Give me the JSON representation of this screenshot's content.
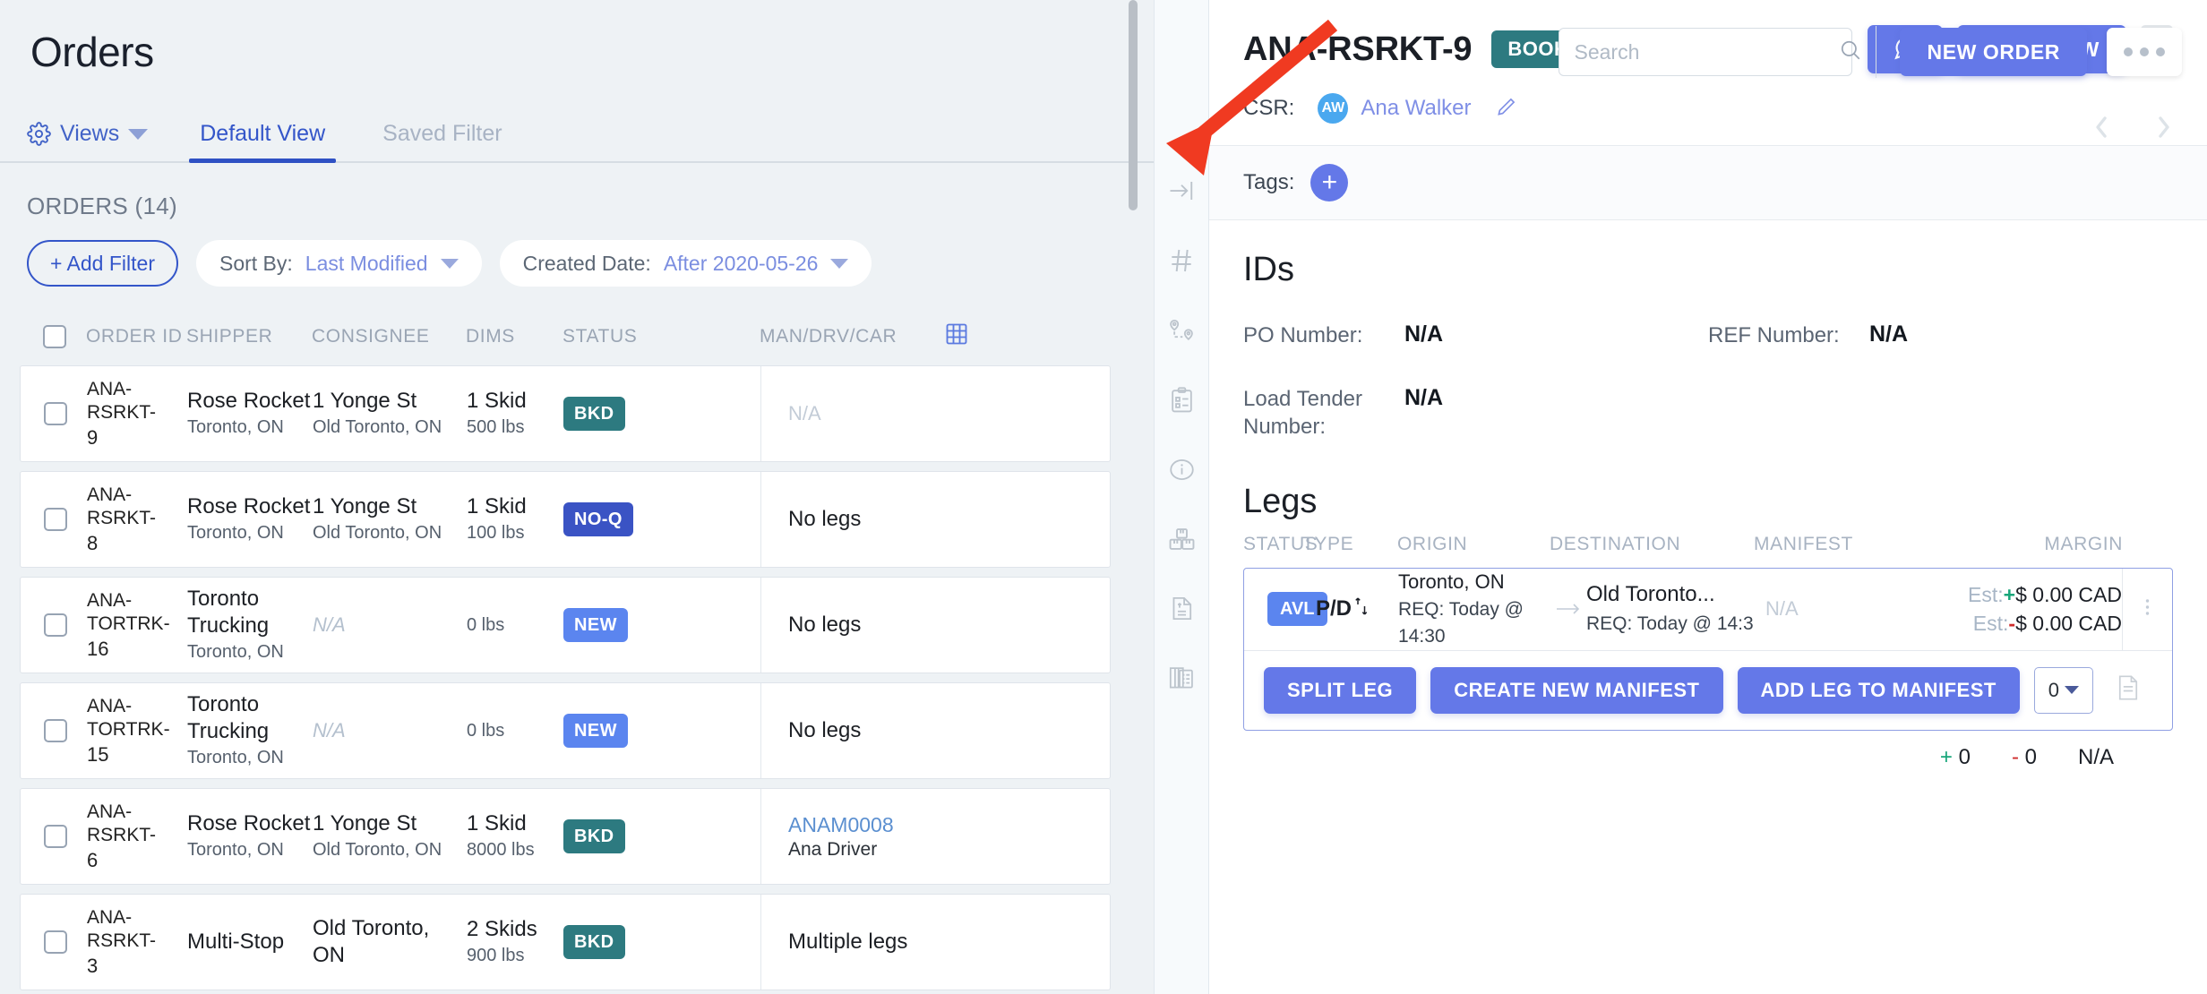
{
  "header": {
    "title": "Orders",
    "search_placeholder": "Search",
    "search_value": "",
    "new_order_label": "NEW ORDER",
    "more_icon": "ellipsis-icon"
  },
  "tabbar": {
    "views_label": "Views",
    "tabs": [
      {
        "label": "Default View",
        "active": true
      },
      {
        "label": "Saved Filter",
        "active": false
      }
    ],
    "prev_icon": "chevron-left-icon",
    "next_icon": "chevron-right-icon"
  },
  "list": {
    "count_label": "ORDERS (14)",
    "add_filter_label": "+ Add Filter",
    "sort_chip": {
      "label": "Sort By:",
      "value": "Last Modified"
    },
    "date_chip": {
      "label": "Created Date:",
      "value": "After 2020-05-26"
    },
    "columns": [
      "ORDER ID",
      "SHIPPER",
      "CONSIGNEE",
      "DIMS",
      "STATUS",
      "MAN/DRV/CAR"
    ],
    "grid_icon": "table-columns-icon",
    "rows": [
      {
        "order_id_top": "ANA-RSRKT-",
        "order_id_bottom": "9",
        "shipper_name": "Rose Rocket",
        "shipper_loc": "Toronto, ON",
        "consignee_name": "1 Yonge St",
        "consignee_loc": "Old Toronto, ON",
        "dims_main": "1 Skid",
        "dims_sub": "500 lbs",
        "status": "BKD",
        "status_type": "bkd",
        "legs_kind": "na",
        "legs_main": "N/A",
        "legs_sub": ""
      },
      {
        "order_id_top": "ANA-RSRKT-",
        "order_id_bottom": "8",
        "shipper_name": "Rose Rocket",
        "shipper_loc": "Toronto, ON",
        "consignee_name": "1 Yonge St",
        "consignee_loc": "Old Toronto, ON",
        "dims_main": "1 Skid",
        "dims_sub": "100 lbs",
        "status": "NO-Q",
        "status_type": "noq",
        "legs_kind": "text",
        "legs_main": "No legs",
        "legs_sub": ""
      },
      {
        "order_id_top": "ANA-TORTRK-",
        "order_id_bottom": "16",
        "shipper_name": "Toronto Trucking",
        "shipper_loc": "Toronto, ON",
        "consignee_name": "N/A",
        "consignee_loc": "",
        "dims_main": "",
        "dims_sub": "0 lbs",
        "status": "NEW",
        "status_type": "new",
        "legs_kind": "text",
        "legs_main": "No legs",
        "legs_sub": ""
      },
      {
        "order_id_top": "ANA-TORTRK-",
        "order_id_bottom": "15",
        "shipper_name": "Toronto Trucking",
        "shipper_loc": "Toronto, ON",
        "consignee_name": "N/A",
        "consignee_loc": "",
        "dims_main": "",
        "dims_sub": "0 lbs",
        "status": "NEW",
        "status_type": "new",
        "legs_kind": "text",
        "legs_main": "No legs",
        "legs_sub": ""
      },
      {
        "order_id_top": "ANA-RSRKT-",
        "order_id_bottom": "6",
        "shipper_name": "Rose Rocket",
        "shipper_loc": "Toronto, ON",
        "consignee_name": "1 Yonge St",
        "consignee_loc": "Old Toronto, ON",
        "dims_main": "1 Skid",
        "dims_sub": "8000 lbs",
        "status": "BKD",
        "status_type": "bkd",
        "legs_kind": "link",
        "legs_main": "ANAM0008",
        "legs_sub": "Ana Driver"
      },
      {
        "order_id_top": "ANA-RSRKT-",
        "order_id_bottom": "3",
        "shipper_name": "Multi-Stop",
        "shipper_loc": "",
        "consignee_name": "Old Toronto, ON",
        "consignee_loc": "",
        "dims_main": "2 Skids",
        "dims_sub": "900 lbs",
        "status": "BKD",
        "status_type": "bkd",
        "legs_kind": "text",
        "legs_main": "Multiple legs",
        "legs_sub": ""
      }
    ]
  },
  "rail": {
    "icons": [
      "collapse-panel-icon",
      "hash-icon",
      "route-pins-icon",
      "clipboard-checklist-icon",
      "info-circle-icon",
      "boxes-icon",
      "invoice-document-icon",
      "documents-stack-icon"
    ]
  },
  "detail": {
    "order_id": "ANA-RSRKT-9",
    "status_badge": "BOOKED",
    "chat_icon": "chat-bubble-icon",
    "full_view_label": "FULL VIEW",
    "kebab_icon": "vertical-ellipsis-icon",
    "csr_label": "CSR:",
    "csr_initials": "AW",
    "csr_name": "Ana Walker",
    "edit_icon": "pencil-icon",
    "tags_label": "Tags:",
    "tag_add_icon": "plus-icon",
    "ids": {
      "section_title": "IDs",
      "po_label": "PO Number:",
      "po_value": "N/A",
      "ref_label": "REF Number:",
      "ref_value": "N/A",
      "load_tender_label": "Load Tender Number:",
      "load_tender_value": "N/A"
    },
    "legs": {
      "section_title": "Legs",
      "columns": [
        "STATUS",
        "TYPE",
        "ORIGIN",
        "DESTINATION",
        "MANIFEST",
        "MARGIN"
      ],
      "row": {
        "status": "AVL",
        "type": "P/D",
        "origin_city": "Toronto, ON",
        "origin_req": "REQ: Today @ 14:30",
        "arrow_icon": "arrow-right-icon",
        "dest_city": "Old Toronto...",
        "dest_req": "REQ: Today @ 14:3",
        "manifest": "N/A",
        "margin_plus_label": "Est:",
        "margin_plus_sign": "+",
        "margin_plus_value": "$ 0.00 CAD",
        "margin_minus_label": "Est:",
        "margin_minus_sign": "-",
        "margin_minus_value": "$ 0.00 CAD",
        "kebab_icon": "vertical-ellipsis-icon"
      },
      "actions": {
        "split_leg": "SPLIT LEG",
        "create_manifest": "CREATE NEW MANIFEST",
        "add_to_manifest": "ADD LEG TO MANIFEST",
        "qty_value": "0",
        "note_icon": "note-icon"
      },
      "totals": {
        "plus_sign": "+",
        "plus_value": "0",
        "minus_sign": "-",
        "minus_value": "0",
        "net_value": "N/A"
      }
    }
  },
  "annotation": {
    "arrow_icon": "red-pointer-arrow",
    "color": "#f03a21"
  },
  "colors": {
    "accent_blue": "#6478e8",
    "link_blue": "#7f8fe6",
    "tab_active": "#2f51c4",
    "badge_bkd": "#2d7a80",
    "badge_noq": "#3a53c4",
    "badge_new": "#5b85ef",
    "positive": "#18a67a",
    "negative": "#cf2b2b",
    "page_bg": "#eef2f5"
  }
}
